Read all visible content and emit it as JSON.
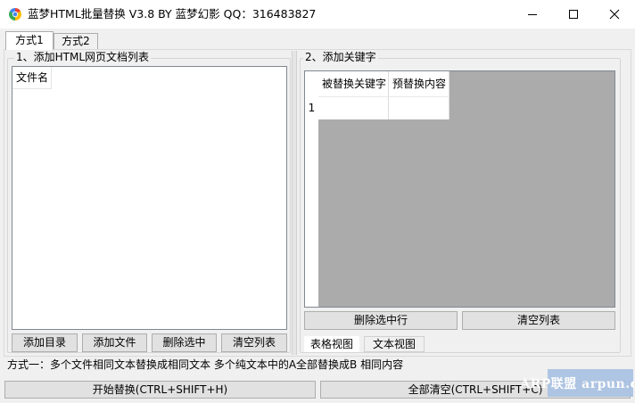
{
  "window": {
    "title": "蓝梦HTML批量替换 V3.8 BY 蓝梦幻影 QQ：316483827",
    "icon": "app-logo-icon",
    "controls": [
      "minimize-icon",
      "maximize-icon",
      "close-icon"
    ]
  },
  "tabs": [
    {
      "label": "方式1",
      "selected": true
    },
    {
      "label": "方式2",
      "selected": false
    }
  ],
  "left_panel": {
    "caption": "1、添加HTML网页文档列表",
    "list": {
      "columns": [
        "文件名"
      ],
      "rows": []
    },
    "buttons": {
      "add_dir": "添加目录",
      "add_file": "添加文件",
      "delete_selected": "删除选中",
      "clear_list": "清空列表"
    }
  },
  "right_panel": {
    "caption": "2、添加关键字",
    "grid": {
      "columns": [
        "被替换关键字",
        "预替换内容"
      ],
      "rows": [
        {
          "index": "1",
          "cells": [
            "",
            ""
          ]
        }
      ]
    },
    "buttons": {
      "delete_row": "删除选中行",
      "clear_list": "清空列表"
    },
    "view_tabs": [
      {
        "label": "表格视图",
        "selected": true
      },
      {
        "label": "文本视图",
        "selected": false
      }
    ]
  },
  "status": {
    "text": "方式一：多个文件相同文本替换成相同文本   多个纯文本中的A全部替换成B 相同内容"
  },
  "actions": {
    "start": "开始替换(CTRL+SHIFT+H)",
    "clear_all": "全部清空(CTRL+SHIFT+C)"
  },
  "watermark": {
    "text": "ARP联盟 arpun.com"
  },
  "colors": {
    "titlebar": "#ffffff",
    "window_bg": "#f0f0f0",
    "button_bg": "#e1e1e1",
    "grid_bg": "#ababab",
    "watermark_bg": "#a9c2e3"
  }
}
